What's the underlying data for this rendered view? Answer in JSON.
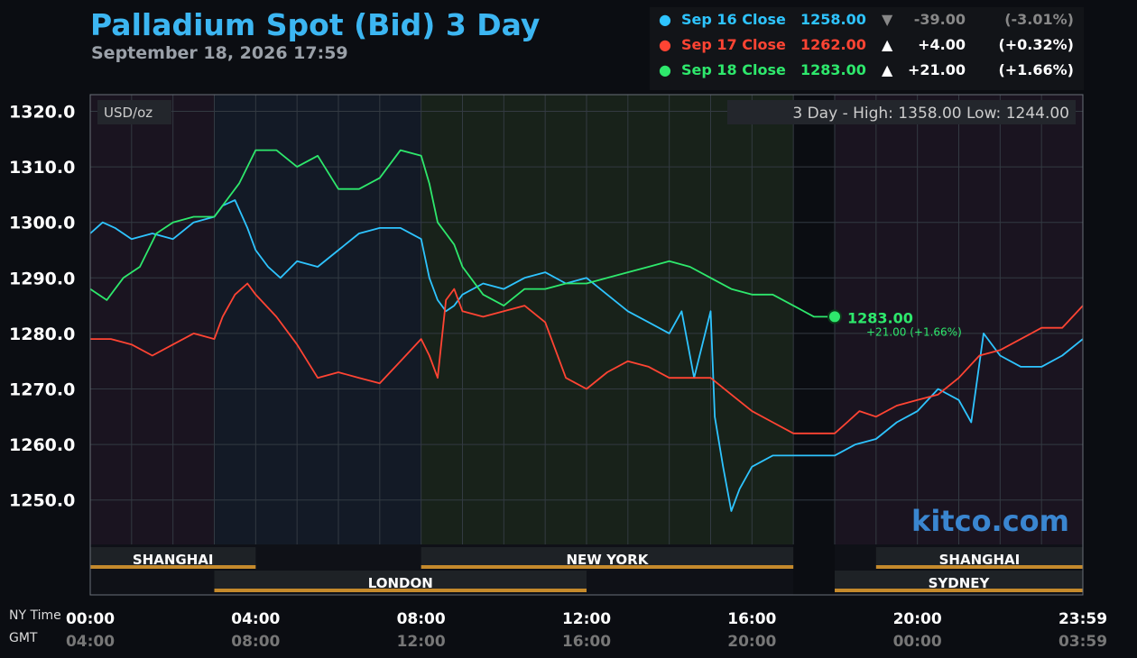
{
  "header": {
    "title": "Palladium Spot (Bid) 3 Day",
    "subtitle": "September 18, 2026 17:59"
  },
  "legend": [
    {
      "label": "Sep 16 Close",
      "close": "1258.00",
      "arrow": "▼",
      "change": "-39.00",
      "pct": "(-3.01%)",
      "color": "#2ec4ff",
      "muted": true
    },
    {
      "label": "Sep 17 Close",
      "close": "1262.00",
      "arrow": "▲",
      "change": "+4.00",
      "pct": "(+0.32%)",
      "color": "#ff4433",
      "muted": false
    },
    {
      "label": "Sep 18 Close",
      "close": "1283.00",
      "arrow": "▲",
      "change": "+21.00",
      "pct": "(+1.66%)",
      "color": "#2ee86c",
      "muted": false
    }
  ],
  "plot": {
    "unit_label": "USD/oz",
    "range_text": "3 Day - High: 1358.00  Low: 1244.00",
    "watermark": "kitco.com",
    "last_price": "1283.00",
    "last_change": "+21.00 (+1.66%)"
  },
  "time_rows": {
    "ny_label": "NY Time",
    "gmt_label": "GMT"
  },
  "x_ticks": [
    {
      "ny": "00:00",
      "gmt": "04:00",
      "h": 0
    },
    {
      "ny": "04:00",
      "gmt": "08:00",
      "h": 4
    },
    {
      "ny": "08:00",
      "gmt": "12:00",
      "h": 8
    },
    {
      "ny": "12:00",
      "gmt": "16:00",
      "h": 12
    },
    {
      "ny": "16:00",
      "gmt": "20:00",
      "h": 16
    },
    {
      "ny": "20:00",
      "gmt": "00:00",
      "h": 20
    },
    {
      "ny": "23:59",
      "gmt": "03:59",
      "h": 24
    }
  ],
  "sessions": [
    {
      "name": "SHANGHAI",
      "start": 0,
      "end": 4,
      "row": 1
    },
    {
      "name": "NEW YORK",
      "start": 8,
      "end": 17,
      "row": 1
    },
    {
      "name": "SHANGHAI",
      "start": 19,
      "end": 24,
      "row": 1
    },
    {
      "name": "LONDON",
      "start": 3,
      "end": 12,
      "row": 2
    },
    {
      "name": "SYDNEY",
      "start": 18,
      "end": 24,
      "row": 2
    }
  ],
  "chart_data": {
    "type": "line",
    "title": "Palladium Spot (Bid) 3 Day",
    "ylabel": "USD/oz",
    "xlim": [
      0,
      24
    ],
    "ylim": [
      1242,
      1323
    ],
    "y_ticks": [
      "1250.0",
      "1260.0",
      "1270.0",
      "1280.0",
      "1290.0",
      "1300.0",
      "1310.0",
      "1320.0"
    ],
    "grid": true,
    "series": [
      {
        "name": "Sep 16",
        "color": "#2ec4ff",
        "x": [
          0,
          0.3,
          0.6,
          1,
          1.5,
          2,
          2.5,
          3,
          3.2,
          3.5,
          3.8,
          4,
          4.3,
          4.6,
          5,
          5.5,
          6,
          6.5,
          7,
          7.5,
          8,
          8.2,
          8.4,
          8.6,
          8.8,
          9,
          9.5,
          10,
          10.5,
          11,
          11.5,
          12,
          12.5,
          13,
          13.5,
          14,
          14.3,
          14.6,
          15,
          15.1,
          15.3,
          15.5,
          15.7,
          16,
          16.5,
          17,
          17.5,
          18,
          18.5,
          19,
          19.5,
          20,
          20.5,
          21,
          21.3,
          21.6,
          22,
          22.5,
          23,
          23.5,
          24
        ],
        "y": [
          1298,
          1300,
          1299,
          1297,
          1298,
          1297,
          1300,
          1301,
          1303,
          1304,
          1299,
          1295,
          1292,
          1290,
          1293,
          1292,
          1295,
          1298,
          1299,
          1299,
          1297,
          1290,
          1286,
          1284,
          1285,
          1287,
          1289,
          1288,
          1290,
          1291,
          1289,
          1290,
          1287,
          1284,
          1282,
          1280,
          1284,
          1272,
          1284,
          1265,
          1256,
          1248,
          1252,
          1256,
          1258,
          1258,
          1258,
          1258,
          1260,
          1261,
          1264,
          1266,
          1270,
          1268,
          1264,
          1280,
          1276,
          1274,
          1274,
          1276,
          1279
        ]
      },
      {
        "name": "Sep 17",
        "color": "#ff4433",
        "x": [
          0,
          0.5,
          1,
          1.5,
          2,
          2.5,
          3,
          3.2,
          3.5,
          3.8,
          4,
          4.5,
          5,
          5.5,
          6,
          6.5,
          7,
          7.5,
          8,
          8.2,
          8.4,
          8.6,
          8.8,
          9,
          9.5,
          10,
          10.5,
          11,
          11.5,
          12,
          12.5,
          13,
          13.5,
          14,
          14.5,
          15,
          15.5,
          16,
          16.5,
          17,
          17.5,
          18,
          18.3,
          18.6,
          19,
          19.5,
          20,
          20.5,
          21,
          21.5,
          22,
          22.5,
          23,
          23.5,
          24
        ],
        "y": [
          1279,
          1279,
          1278,
          1276,
          1278,
          1280,
          1279,
          1283,
          1287,
          1289,
          1287,
          1283,
          1278,
          1272,
          1273,
          1272,
          1271,
          1275,
          1279,
          1276,
          1272,
          1286,
          1288,
          1284,
          1283,
          1284,
          1285,
          1282,
          1272,
          1270,
          1273,
          1275,
          1274,
          1272,
          1272,
          1272,
          1269,
          1266,
          1264,
          1262,
          1262,
          1262,
          1264,
          1266,
          1265,
          1267,
          1268,
          1269,
          1272,
          1276,
          1277,
          1279,
          1281,
          1281,
          1285
        ]
      },
      {
        "name": "Sep 18",
        "color": "#2ee86c",
        "x": [
          0,
          0.4,
          0.8,
          1.2,
          1.6,
          2,
          2.5,
          3,
          3.3,
          3.6,
          4,
          4.5,
          5,
          5.5,
          6,
          6.5,
          7,
          7.5,
          8,
          8.2,
          8.4,
          8.6,
          8.8,
          9,
          9.5,
          10,
          10.5,
          11,
          11.5,
          12,
          12.5,
          13,
          13.5,
          14,
          14.5,
          15,
          15.5,
          16,
          16.5,
          17,
          17.5,
          18
        ],
        "y": [
          1288,
          1286,
          1290,
          1292,
          1298,
          1300,
          1301,
          1301,
          1304,
          1307,
          1313,
          1313,
          1310,
          1312,
          1306,
          1306,
          1308,
          1313,
          1312,
          1307,
          1300,
          1298,
          1296,
          1292,
          1287,
          1285,
          1288,
          1288,
          1289,
          1289,
          1290,
          1291,
          1292,
          1293,
          1292,
          1290,
          1288,
          1287,
          1287,
          1285,
          1283,
          1283
        ]
      }
    ]
  }
}
